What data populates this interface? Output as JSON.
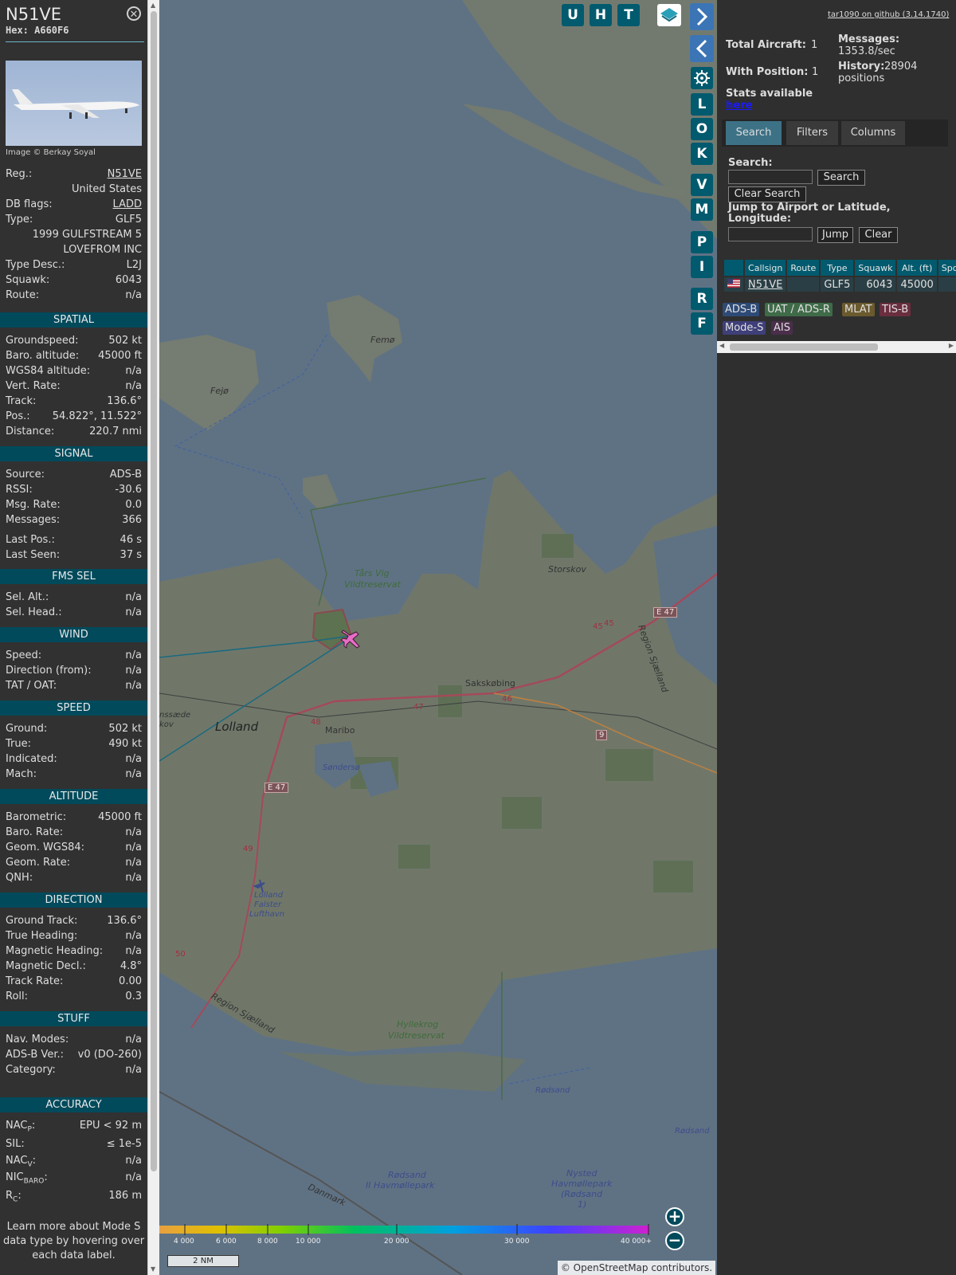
{
  "aircraft": {
    "callsign": "N51VE",
    "hex": "Hex: A660F6",
    "photo_credit": "Image © Berkay Soyal"
  },
  "details": {
    "reg_label": "Reg.:",
    "reg": "N51VE",
    "country": "United States",
    "dbflags_label": "DB flags:",
    "dbflags": "LADD",
    "type_label": "Type:",
    "type": "GLF5",
    "model": "1999 GULFSTREAM 5",
    "owner": "LOVEFROM INC",
    "typedesc_label": "Type Desc.:",
    "typedesc": "L2J",
    "squawk_label": "Squawk:",
    "squawk": "6043",
    "route_label": "Route:",
    "route": "n/a"
  },
  "sections": {
    "spatial": "SPATIAL",
    "signal": "SIGNAL",
    "fms": "FMS SEL",
    "wind": "WIND",
    "speed": "SPEED",
    "altitude": "ALTITUDE",
    "direction": "DIRECTION",
    "stuff": "STUFF",
    "accuracy": "ACCURACY"
  },
  "spatial": {
    "gs_label": "Groundspeed:",
    "gs": "502 kt",
    "baro_label": "Baro. altitude:",
    "baro": "45000 ft",
    "wgs_label": "WGS84 altitude:",
    "wgs": "n/a",
    "vr_label": "Vert. Rate:",
    "vr": "n/a",
    "track_label": "Track:",
    "track": "136.6°",
    "pos_label": "Pos.:",
    "pos": "54.822°, 11.522°",
    "dist_label": "Distance:",
    "dist": "220.7 nmi"
  },
  "signal": {
    "source_label": "Source:",
    "source": "ADS-B",
    "rssi_label": "RSSI:",
    "rssi": "-30.6",
    "msgrate_label": "Msg. Rate:",
    "msgrate": "0.0",
    "messages_label": "Messages:",
    "messages": "366",
    "lastpos_label": "Last Pos.:",
    "lastpos": "46 s",
    "lastseen_label": "Last Seen:",
    "lastseen": "37 s"
  },
  "fms": {
    "selalt_label": "Sel. Alt.:",
    "selalt": "n/a",
    "selhead_label": "Sel. Head.:",
    "selhead": "n/a"
  },
  "wind": {
    "speed_label": "Speed:",
    "speed": "n/a",
    "dir_label": "Direction (from):",
    "dir": "n/a",
    "tat_label": "TAT / OAT:",
    "tat": "n/a"
  },
  "speed": {
    "ground_label": "Ground:",
    "ground": "502 kt",
    "true_label": "True:",
    "true": "490 kt",
    "ind_label": "Indicated:",
    "ind": "n/a",
    "mach_label": "Mach:",
    "mach": "n/a"
  },
  "altitude": {
    "baro_label": "Barometric:",
    "baro": "45000 ft",
    "barorate_label": "Baro. Rate:",
    "barorate": "n/a",
    "geom_label": "Geom. WGS84:",
    "geom": "n/a",
    "geomrate_label": "Geom. Rate:",
    "geomrate": "n/a",
    "qnh_label": "QNH:",
    "qnh": "n/a"
  },
  "direction": {
    "gt_label": "Ground Track:",
    "gt": "136.6°",
    "th_label": "True Heading:",
    "th": "n/a",
    "mh_label": "Magnetic Heading:",
    "mh": "n/a",
    "md_label": "Magnetic Decl.:",
    "md": "4.8°",
    "tr_label": "Track Rate:",
    "tr": "0.00",
    "roll_label": "Roll:",
    "roll": "0.3"
  },
  "stuff": {
    "nav_label": "Nav. Modes:",
    "nav": "n/a",
    "adsb_label": "ADS-B Ver.:",
    "adsb": "v0 (DO-260)",
    "cat_label": "Category:",
    "cat": "n/a"
  },
  "accuracy": {
    "nacp_label": "NAC",
    "nacp_sub": "P",
    "nacp": "EPU < 92 m",
    "sil_label": "SIL:",
    "sil": "≤ 1e-5",
    "nacv_label": "NAC",
    "nacv_sub": "V",
    "nacv": "n/a",
    "nicbaro_label": "NIC",
    "nicbaro_sub": "BARO",
    "nicbaro": "n/a",
    "rc_label": "R",
    "rc_sub": "C",
    "rc": "186 m"
  },
  "learn_more": "Learn more about Mode S data type by hovering over each data label.",
  "map": {
    "buttons_top": [
      "U",
      "H",
      "T"
    ],
    "buttons_side": [
      "L",
      "O",
      "K",
      "V",
      "M",
      "P",
      "I",
      "R",
      "F"
    ],
    "labels": {
      "femo": "Femø",
      "fejo": "Fejø",
      "tars1": "Tårs Vig",
      "tars2": "Vildtreservat",
      "storskov": "Storskov",
      "sakskobing": "Sakskøbing",
      "lolland": "Lolland",
      "maribo": "Maribo",
      "sondersø": "Søndersø",
      "lolland_f1": "Lolland",
      "lolland_f2": "Falster",
      "lolland_f3": "Lufthavn",
      "hyllekrog1": "Hyllekrog",
      "hyllekrog2": "Vildtreservat",
      "rodsand1": "Rødsand",
      "rodsand2": "Rødsand",
      "rodsand_park1": "Rødsand",
      "rodsand_park2": "II Havmøllepark",
      "nysted1": "Nysted",
      "nysted2": "Havmøllepark",
      "nysted3": "(Rødsand",
      "nysted4": "1)",
      "region_sj1": "Region Sjælland",
      "region_sj2": "Region Sjælland",
      "danmark": "Danmark",
      "nssaede": "nssæde",
      "kov": "kov",
      "e47a": "E 47",
      "e47b": "E 47",
      "r9": "9",
      "r45a": "45",
      "r45b": "45",
      "r46": "46",
      "r47": "47",
      "r48": "48",
      "r49": "49",
      "r50": "50"
    },
    "altitude_ticks": [
      "4 000",
      "6 000",
      "8 000",
      "10 000",
      "20 000",
      "30 000",
      "40 000+"
    ],
    "scale": "2 NM",
    "attribution": "© OpenStreetMap contributors."
  },
  "right": {
    "github": "tar1090 on github (3.14.1740)",
    "total_label": "Total Aircraft:",
    "total": "1",
    "withpos_label": "With Position:",
    "withpos": "1",
    "messages_label": "Messages:",
    "messages": "1353.8/sec",
    "history_label": "History:",
    "history": "28904 positions",
    "stats": "Stats available",
    "stats_link": "here",
    "tabs": [
      "Search",
      "Filters",
      "Columns"
    ],
    "search_label": "Search:",
    "search_btn": "Search",
    "clear_search_btn": "Clear Search",
    "jump_label": "Jump to Airport or Latitude, Longitude:",
    "jump_btn": "Jump",
    "clear_btn": "Clear",
    "columns": [
      "Callsign",
      "Route",
      "Type",
      "Squawk",
      "Alt. (ft)",
      "Spd."
    ],
    "row": {
      "callsign": "N51VE",
      "route": "",
      "type": "GLF5",
      "squawk": "6043",
      "alt": "45000",
      "spd": ""
    },
    "legend": [
      "ADS-B",
      "UAT / ADS-R",
      "MLAT",
      "TIS-B",
      "Mode-S",
      "AIS"
    ]
  },
  "colors": {
    "accent": "#014a5b",
    "plane": "#e96cc6",
    "legend_adsb": "#2e4a76",
    "legend_uat": "#3f6b48",
    "legend_mlat": "#6a5a2e",
    "legend_tisb": "#6a2e3e",
    "legend_modes": "#3f3f7a",
    "legend_ais": "#4a2e4a"
  }
}
